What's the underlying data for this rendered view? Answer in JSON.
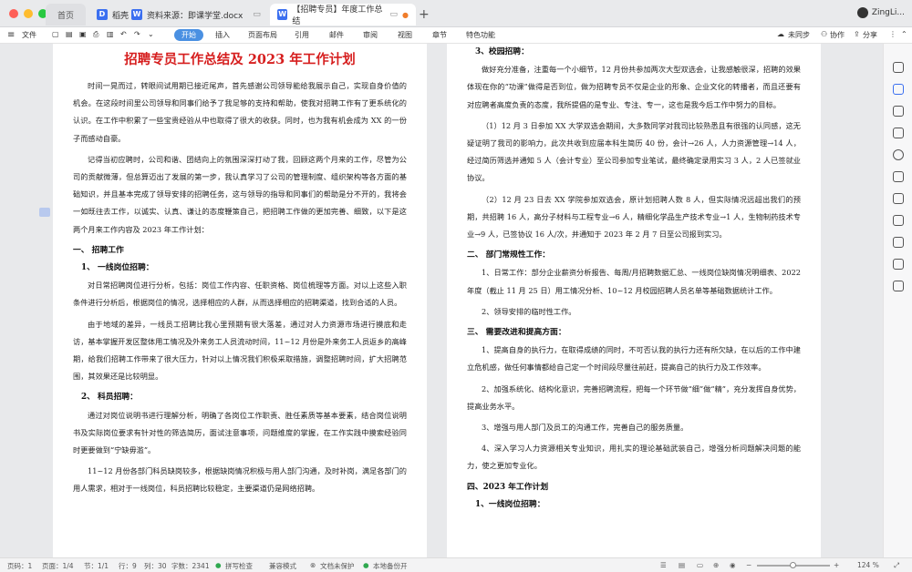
{
  "tabs": {
    "home": "首页",
    "shell": "稻壳",
    "doc1": "资料来源：即课学堂.docx",
    "doc2": "【招聘专员】年度工作总结"
  },
  "user": {
    "name": "ZingLi..."
  },
  "menu": {
    "file": "文件",
    "start": "开始",
    "insert": "插入",
    "layout": "页面布局",
    "ref": "引用",
    "mail": "邮件",
    "review": "审阅",
    "view": "视图",
    "chapter": "章节",
    "features": "特色功能",
    "unsynced": "未同步",
    "collab": "协作",
    "share": "分享"
  },
  "doc": {
    "title": "招聘专员工作总结及 2023 年工作计划",
    "left": [
      {
        "type": "p",
        "text": "时间一晃而过，转眼间试用期已接近尾声，首先感谢公司领导能给我展示自己，实现自身价值的机会。在这段时间里公司领导和同事们给予了我足够的支持和帮助，使我对招聘工作有了更系统化的认识。在工作中积累了一些宝贵经验从中也取得了很大的收获。同时，也为我有机会成为 XX 的一份子而感动自豪。"
      },
      {
        "type": "p",
        "text": "记得当初应聘时，公司和谐、团结向上的氛围深深打动了我，回顾这两个月来的工作，尽管为公司的贡献微薄，但总算迈出了发展的第一步，我认真学习了公司的管理制度、组织架构等各方面的基础知识，并且基本完成了领导安排的招聘任务，这与领导的指导和同事们的帮助是分不开的，我将会一如既往去工作，以诚实、认真、谦让的态度鞭策自己，把招聘工作做的更加完善、细致，以下是这两个月来工作内容及 2023 年工作计划："
      },
      {
        "type": "h1",
        "text": "一、 招聘工作"
      },
      {
        "type": "h2",
        "text": "1、   一线岗位招聘："
      },
      {
        "type": "p",
        "text": "对日常招聘岗位进行分析，包括：岗位工作内容、任职资格、岗位梳理等方面。对以上这些入职条件进行分析后，根据岗位的情况，选择相应的人群，从而选择相应的招聘渠道，找到合适的人员。"
      },
      {
        "type": "p",
        "text": "由于地域的差异，一线员工招聘比我心里预期有很大落差，通过对人力资源市场进行摸底和走访，基本掌握开发区整体用工情况及外来务工人员流动时间，11~12 月份是外来务工人员返乡的高峰期，给我们招聘工作带来了很大压力，针对以上情况我们积极采取措施，调整招聘时间，扩大招聘范围，其效果还是比较明显。"
      },
      {
        "type": "h2",
        "text": "2、   科员招聘："
      },
      {
        "type": "p",
        "text": "通过对岗位说明书进行理解分析，明确了各岗位工作职责、胜任素质等基本要素，结合岗位说明书及实际岗位要求有针对性的筛选简历，面试注意事项，问题维度的掌握，在工作实践中摸索经验同时更要做到“宁缺毋滥”。"
      },
      {
        "type": "p",
        "text": "11~12 月份各部门科员缺岗较多，根据缺岗情况积极与用人部门沟通，及时补岗，满足各部门的用人需求，相对于一线岗位，科员招聘比较稳定，主要渠道仍是网络招聘。"
      }
    ],
    "right": [
      {
        "type": "h2",
        "text": "3、校园招聘："
      },
      {
        "type": "p",
        "text": "做好充分准备，注重每一个小细节，12 月份共参加两次大型双选会，让我感触很深，招聘的效果体现在你的“功课”做得是否到位，做为招聘专员不仅是企业的形象、企业文化的转播者，而且还要有对应聘者高度负责的态度，我所提倡的是专业、专注、专一，这也是我今后工作中努力的目标。"
      },
      {
        "type": "p",
        "text": "（1）12 月 3 日参加 XX 大学双选会期间，大多数同学对我司比较熟悉且有很强的认同感，这无疑证明了我司的影响力，此次共收到应届本科生简历 40 份，会计→26 人，人力资源管理→14 人，经过简历筛选并通知 5 人（会计专业）至公司参加专业笔试，最终确定录用实习 3 人，2 人已签就业协议。"
      },
      {
        "type": "p",
        "text": "（2）12 月 23 日去 XX 学院参加双选会，原计划招聘人数 8 人，但实际情况远超出我们的预期，共招聘 16 人，高分子材料与工程专业→6 人，精细化学品生产技术专业→1 人，生物制药技术专业→9 人，已签协议 16 人/次，并通知于 2023 年 2 月 7 日至公司报到实习。"
      },
      {
        "type": "h1",
        "text": "二、 部门常规性工作："
      },
      {
        "type": "p",
        "text": "1、日常工作：部分企业薪资分析报告、每周/月招聘数据汇总、一线岗位缺岗情况明细表、2022 年度（截止 11 月 25 日）用工情况分析、10~12 月校园招聘人员名单等基础数据统计工作。"
      },
      {
        "type": "p",
        "text": "2、领导安排的临时性工作。"
      },
      {
        "type": "h1",
        "text": "三、 需要改进和提高方面："
      },
      {
        "type": "p",
        "text": "1、提高自身的执行力，在取得成绩的同时，不可否认我的执行力还有所欠缺，在以后的工作中建立危机感，做任何事情都给自己定一个时间段尽量往前赶，提高自己的执行力及工作效率。"
      },
      {
        "type": "p",
        "text": "2、加强系统化、结构化意识，完善招聘流程，把每一个环节做“细”做“精”，充分发挥自身优势，提高业务水平。"
      },
      {
        "type": "p",
        "text": "3、增强与用人部门及员工的沟通工作，完善自己的服务质量。"
      },
      {
        "type": "p",
        "text": "4、深入学习人力资源相关专业知识，用扎实的理论基础武装自己，增强分析问题解决问题的能力，使之更加专业化。"
      },
      {
        "type": "h1",
        "text": "四、2023 年工作计划"
      },
      {
        "type": "h2",
        "text": "1、一线岗位招聘："
      }
    ]
  },
  "status": {
    "page_no": "页码：1",
    "pages": "页面：1/4",
    "section": "节：1/1",
    "row": "行：9",
    "col": "列：30",
    "words": "字数：2341",
    "spell": "拼写检查",
    "compat": "兼容模式",
    "protect": "文档未保护",
    "backup": "本地备份开",
    "zoom": "124 %"
  }
}
